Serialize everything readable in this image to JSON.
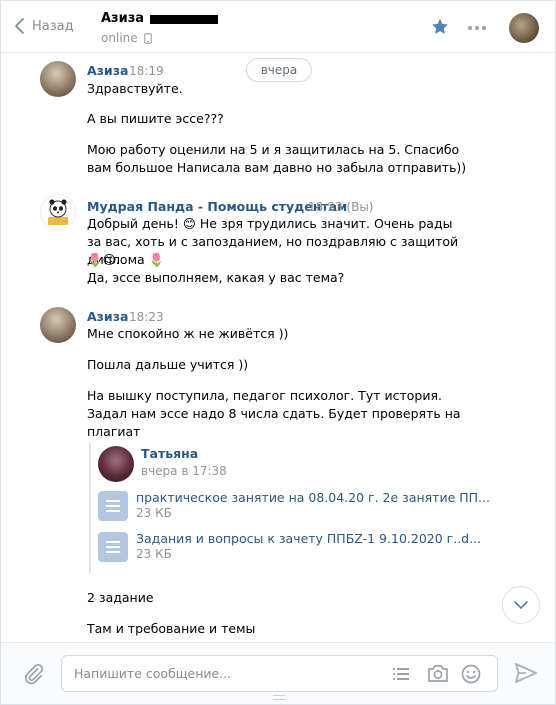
{
  "header": {
    "back_label": "Назад",
    "peer_name": "Азиза",
    "peer_status": "online"
  },
  "history": {
    "date_divider": "вчера",
    "messages": [
      {
        "author": "Азиза",
        "time": "18:19",
        "lines": [
          "Здравствуйте.",
          "А вы пишите эссе???",
          "Мою работу оценили на 5 и я защитилась на 5. Спасибо вам большое Написала вам давно но забыла отправить))"
        ]
      },
      {
        "author": "Мудрая Панда - Помощь студентам",
        "time": "18:23",
        "sender_note": "(Вы)",
        "lines": [
          "Добрый день! 😊 Не зря трудились значит. Очень рады за вас, хоть и с запозданием, но поздравляю с защитой диплома 🌷",
          "🌷😊.",
          "Да, эссе выполняем, какая у вас тема?"
        ]
      },
      {
        "author": "Азиза",
        "time": "18:23",
        "lines": [
          "Мне спокойно ж не живётся ))",
          "Пошла дальше учится ))",
          "На вышку поступила, педагог психолог. Тут история. Задал нам эссе надо 8 числа сдать. Будет проверять на плагиат"
        ],
        "forwarded": {
          "author": "Татьяна",
          "time": "вчера в 17:38",
          "docs": [
            {
              "name": "практическое занятие на 08.04.20 г. 2е занятие ПП...",
              "size": "23 КБ"
            },
            {
              "name": "Задания и вопросы к зачету ППБZ-1 9.10.2020 г..d...",
              "size": "23 КБ"
            }
          ]
        },
        "after_lines": [
          "2 задание",
          "Там и требование и темы"
        ]
      }
    ]
  },
  "composer": {
    "placeholder": "Напишите сообщение..."
  },
  "colors": {
    "link": "#2a5885",
    "accent": "#5181b8",
    "muted": "#939393"
  }
}
